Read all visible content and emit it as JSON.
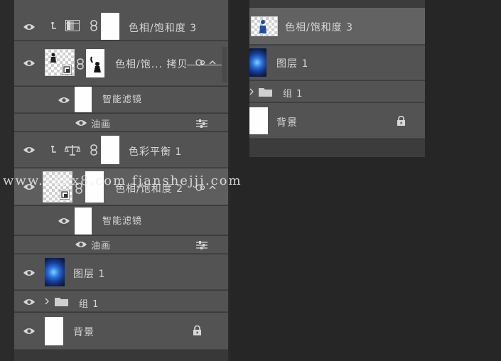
{
  "layers_panel": {
    "rows": [
      {
        "label": "色相/饱和度 3"
      },
      {
        "label": "色相/饱... 拷贝"
      },
      {
        "label": "智能滤镜"
      },
      {
        "label": "油画"
      },
      {
        "label": "色彩平衡 1"
      },
      {
        "label": "色相/饱和度 2"
      },
      {
        "label": "智能滤镜"
      },
      {
        "label": "油画"
      },
      {
        "label": "图层 1"
      },
      {
        "label": "组 1"
      },
      {
        "label": "背景"
      }
    ]
  },
  "mini_panel": {
    "rows": [
      {
        "label": "色相/饱和度 3"
      },
      {
        "label": "图层 1"
      },
      {
        "label": "组 1"
      },
      {
        "label": "背景"
      }
    ]
  },
  "watermark": {
    "text": "www.16xx8.com  fjanshejji.com"
  },
  "colors": {
    "panel": "#535353",
    "background": "#262626",
    "text": "#d6d6d6"
  }
}
